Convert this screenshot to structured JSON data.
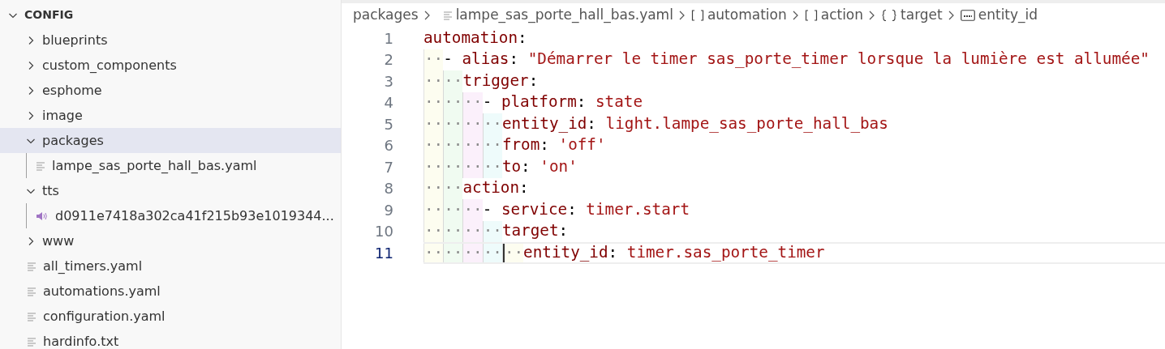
{
  "explorer": {
    "title": "CONFIG",
    "expanded": true,
    "items": [
      {
        "kind": "folder",
        "name": "blueprints",
        "expanded": false,
        "selected": false
      },
      {
        "kind": "folder",
        "name": "custom_components",
        "expanded": false,
        "selected": false
      },
      {
        "kind": "folder",
        "name": "esphome",
        "expanded": false,
        "selected": false
      },
      {
        "kind": "folder",
        "name": "image",
        "expanded": false,
        "selected": false
      },
      {
        "kind": "folder",
        "name": "packages",
        "expanded": true,
        "selected": true,
        "children": [
          {
            "kind": "file",
            "name": "lampe_sas_porte_hall_bas.yaml",
            "selected": false
          }
        ]
      },
      {
        "kind": "folder",
        "name": "tts",
        "expanded": true,
        "selected": false,
        "children": [
          {
            "kind": "audio",
            "name": "d0911e7418a302ca41f215b93e1019344...",
            "selected": false
          }
        ]
      },
      {
        "kind": "folder",
        "name": "www",
        "expanded": false,
        "selected": false
      },
      {
        "kind": "file",
        "name": "all_timers.yaml",
        "selected": false
      },
      {
        "kind": "file",
        "name": "automations.yaml",
        "selected": false
      },
      {
        "kind": "file",
        "name": "configuration.yaml",
        "selected": false
      },
      {
        "kind": "file",
        "name": "hardinfo.txt",
        "selected": false
      }
    ]
  },
  "breadcrumb": [
    {
      "kind": "folder",
      "label": "packages"
    },
    {
      "kind": "file",
      "label": "lampe_sas_porte_hall_bas.yaml"
    },
    {
      "kind": "array",
      "label": "automation"
    },
    {
      "kind": "array",
      "label": "action"
    },
    {
      "kind": "object",
      "label": "target"
    },
    {
      "kind": "string",
      "label": "entity_id"
    }
  ],
  "editor": {
    "lines": [
      {
        "number": "1",
        "current": false,
        "tokens": [
          {
            "kind": "key",
            "text": "automation"
          },
          {
            "kind": "punct",
            "text": ":"
          }
        ]
      },
      {
        "number": "2",
        "current": false,
        "indent": "··",
        "tokens": [
          {
            "kind": "punct",
            "text": "- "
          },
          {
            "kind": "key",
            "text": "alias"
          },
          {
            "kind": "punct",
            "text": ": "
          },
          {
            "kind": "value",
            "text": "\"Démarrer le timer sas_porte_timer lorsque la lumière est allumée\""
          }
        ]
      },
      {
        "number": "3",
        "current": false,
        "indent": "····",
        "tokens": [
          {
            "kind": "key",
            "text": "trigger"
          },
          {
            "kind": "punct",
            "text": ":"
          }
        ]
      },
      {
        "number": "4",
        "current": false,
        "indent": "······",
        "tokens": [
          {
            "kind": "punct",
            "text": "- "
          },
          {
            "kind": "key",
            "text": "platform"
          },
          {
            "kind": "punct",
            "text": ": "
          },
          {
            "kind": "value",
            "text": "state"
          }
        ]
      },
      {
        "number": "5",
        "current": false,
        "indent": "········",
        "tokens": [
          {
            "kind": "key",
            "text": "entity_id"
          },
          {
            "kind": "punct",
            "text": ": "
          },
          {
            "kind": "value",
            "text": "light.lampe_sas_porte_hall_bas"
          }
        ]
      },
      {
        "number": "6",
        "current": false,
        "indent": "········",
        "tokens": [
          {
            "kind": "key",
            "text": "from"
          },
          {
            "kind": "punct",
            "text": ": "
          },
          {
            "kind": "value",
            "text": "'off'"
          }
        ]
      },
      {
        "number": "7",
        "current": false,
        "indent": "········",
        "tokens": [
          {
            "kind": "key",
            "text": "to"
          },
          {
            "kind": "punct",
            "text": ": "
          },
          {
            "kind": "value",
            "text": "'on'"
          }
        ]
      },
      {
        "number": "8",
        "current": false,
        "indent": "····",
        "tokens": [
          {
            "kind": "key",
            "text": "action"
          },
          {
            "kind": "punct",
            "text": ":"
          }
        ]
      },
      {
        "number": "9",
        "current": false,
        "indent": "······",
        "tokens": [
          {
            "kind": "punct",
            "text": "- "
          },
          {
            "kind": "key",
            "text": "service"
          },
          {
            "kind": "punct",
            "text": ": "
          },
          {
            "kind": "value",
            "text": "timer.start"
          }
        ]
      },
      {
        "number": "10",
        "current": false,
        "indent": "········",
        "tokens": [
          {
            "kind": "key",
            "text": "target"
          },
          {
            "kind": "punct",
            "text": ":"
          }
        ]
      },
      {
        "number": "11",
        "current": true,
        "indent": "··········",
        "tokens": [
          {
            "kind": "key",
            "text": "entity_id"
          },
          {
            "kind": "punct",
            "text": ": "
          },
          {
            "kind": "value",
            "text": "timer.sas_porte_timer"
          }
        ]
      }
    ]
  }
}
